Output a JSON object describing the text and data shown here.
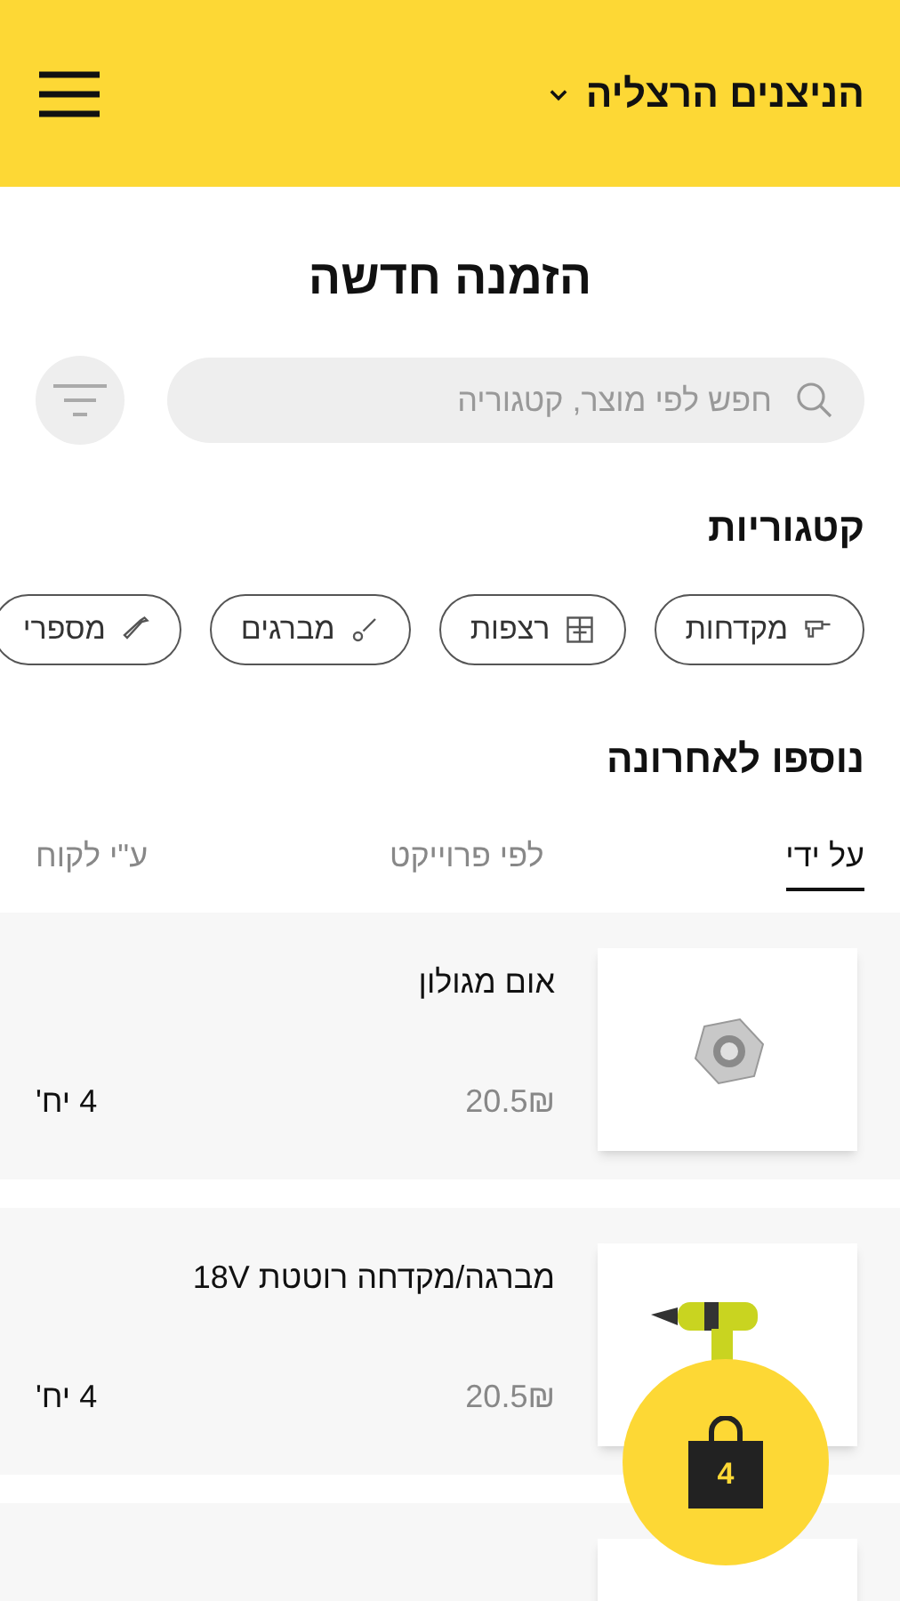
{
  "header": {
    "store": "הניצנים הרצליה"
  },
  "title": "הזמנה חדשה",
  "search": {
    "placeholder": "חפש לפי מוצר, קטגוריה"
  },
  "categories": {
    "heading": "קטגוריות",
    "items": [
      {
        "label": "מקדחות",
        "kind": "drill"
      },
      {
        "label": "רצפות",
        "kind": "tiles"
      },
      {
        "label": "מברגים",
        "kind": "screwdriver"
      },
      {
        "label": "מספרי",
        "kind": "nail"
      }
    ]
  },
  "recent": {
    "heading": "נוספו לאחרונה",
    "tabs": [
      {
        "label": "על ידי",
        "selected": true
      },
      {
        "label": "לפי פרוייקט",
        "selected": false
      },
      {
        "label": "ע\"י לקוח",
        "selected": false
      }
    ]
  },
  "products": [
    {
      "name": "אום מגולון",
      "price": "20.5₪",
      "qty": "4 יח'",
      "kind": "nut"
    },
    {
      "name": "מברגה/מקדחה רוטטת 18V",
      "price": "20.5₪",
      "qty": "4 יח'",
      "kind": "drill"
    },
    {
      "kind": "blank"
    }
  ],
  "cart": {
    "count": "4"
  }
}
